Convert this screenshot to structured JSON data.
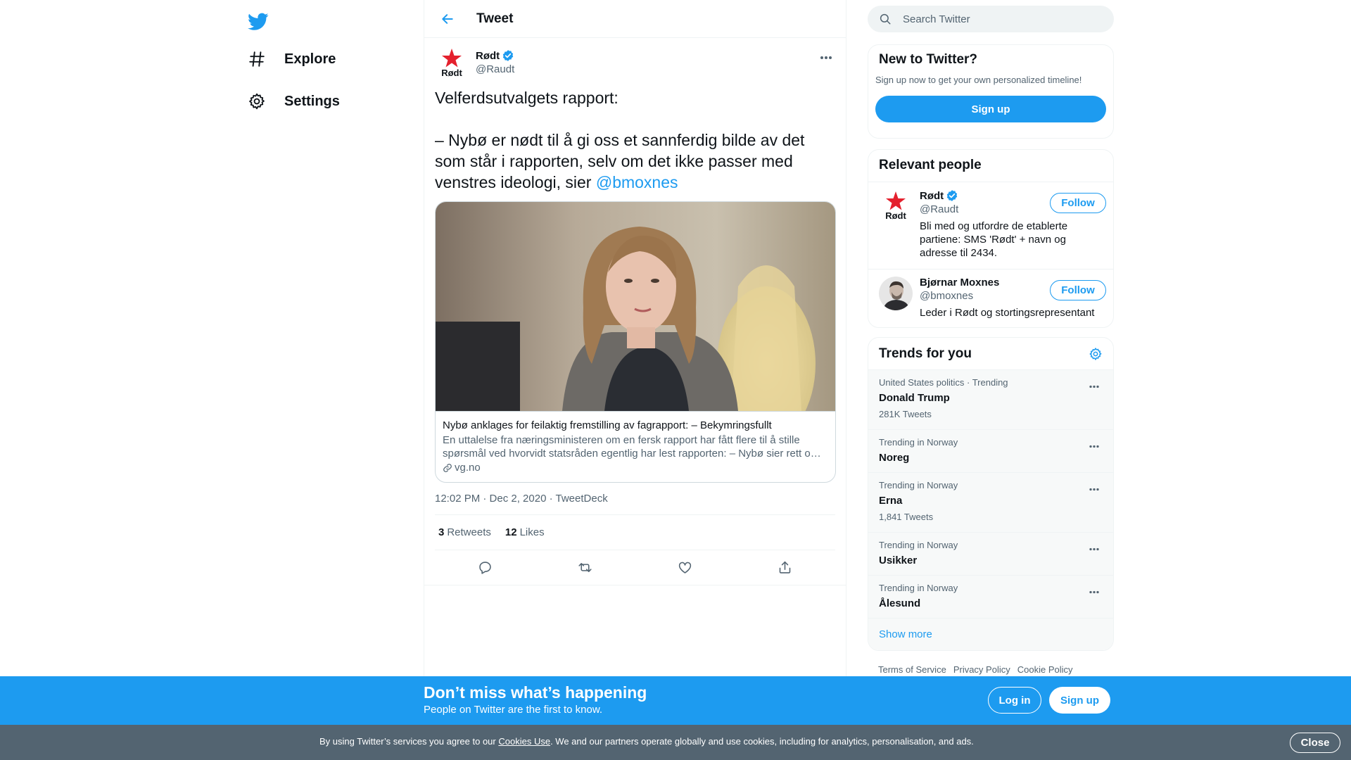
{
  "nav": {
    "logo_icon": "twitter-bird-icon",
    "items": [
      {
        "label": "Explore",
        "icon": "hashtag-icon"
      },
      {
        "label": "Settings",
        "icon": "gear-icon"
      }
    ]
  },
  "main": {
    "title": "Tweet",
    "tweet": {
      "author_name": "Rødt",
      "author_handle": "@Raudt",
      "avatar_text": "Rødt",
      "text_before": "Velferdsutvalgets rapport:\n\n– Nybø er nødt til å gi oss et sannferdig bilde av det som står i rapporten, selv om det ikke passer med venstres ideologi, sier ",
      "mention": "@bmoxnes",
      "card": {
        "title": "Nybø anklages for feilaktig fremstilling av fagrapport: – Bekymringsfullt",
        "description": "En uttalelse fra næringsministeren om en fersk rapport har fått flere til å stille spørsmål ved hvorvidt statsråden egentlig har lest rapporten: – Nybø sier rett o…",
        "domain": "vg.no"
      },
      "time": "12:02 PM · Dec 2, 2020",
      "separator": " · ",
      "source": "TweetDeck",
      "retweets_count": "3",
      "retweets_label": "Retweets",
      "likes_count": "12",
      "likes_label": "Likes"
    }
  },
  "sidebar": {
    "search_placeholder": "Search Twitter",
    "new_to_twitter": {
      "title": "New to Twitter?",
      "subtitle": "Sign up now to get your own personalized timeline!",
      "button": "Sign up"
    },
    "relevant_people": {
      "title": "Relevant people",
      "people": [
        {
          "name": "Rødt",
          "handle": "@Raudt",
          "bio": "Bli med og utfordre de etablerte partiene: SMS 'Rødt' + navn og adresse til 2434.",
          "follow": "Follow",
          "avatar_text": "Rødt"
        },
        {
          "name": "Bjørnar Moxnes",
          "handle": "@bmoxnes",
          "bio": "Leder i Rødt og stortingsrepresentant",
          "follow": "Follow"
        }
      ]
    },
    "trends": {
      "title": "Trends for you",
      "items": [
        {
          "context": "United States politics · Trending",
          "name": "Donald Trump",
          "count": "281K Tweets"
        },
        {
          "context": "Trending in Norway",
          "name": "Noreg",
          "count": ""
        },
        {
          "context": "Trending in Norway",
          "name": "Erna",
          "count": "1,841 Tweets"
        },
        {
          "context": "Trending in Norway",
          "name": "Usikker",
          "count": ""
        },
        {
          "context": "Trending in Norway",
          "name": "Ålesund",
          "count": ""
        }
      ],
      "show_more": "Show more"
    },
    "footer": [
      "Terms of Service",
      "Privacy Policy",
      "Cookie Policy"
    ]
  },
  "banner": {
    "title": "Don’t miss what’s happening",
    "subtitle": "People on Twitter are the first to know.",
    "login": "Log in",
    "signup": "Sign up"
  },
  "cookie": {
    "text_before": "By using Twitter’s services you agree to our ",
    "link": "Cookies Use",
    "text_after": ". We and our partners operate globally and use cookies, including for analytics, personalisation, and ads.",
    "close": "Close"
  },
  "colors": {
    "accent": "#1d9bf0",
    "cookie_bar": "#536471",
    "rodt_red": "#e4202d"
  }
}
